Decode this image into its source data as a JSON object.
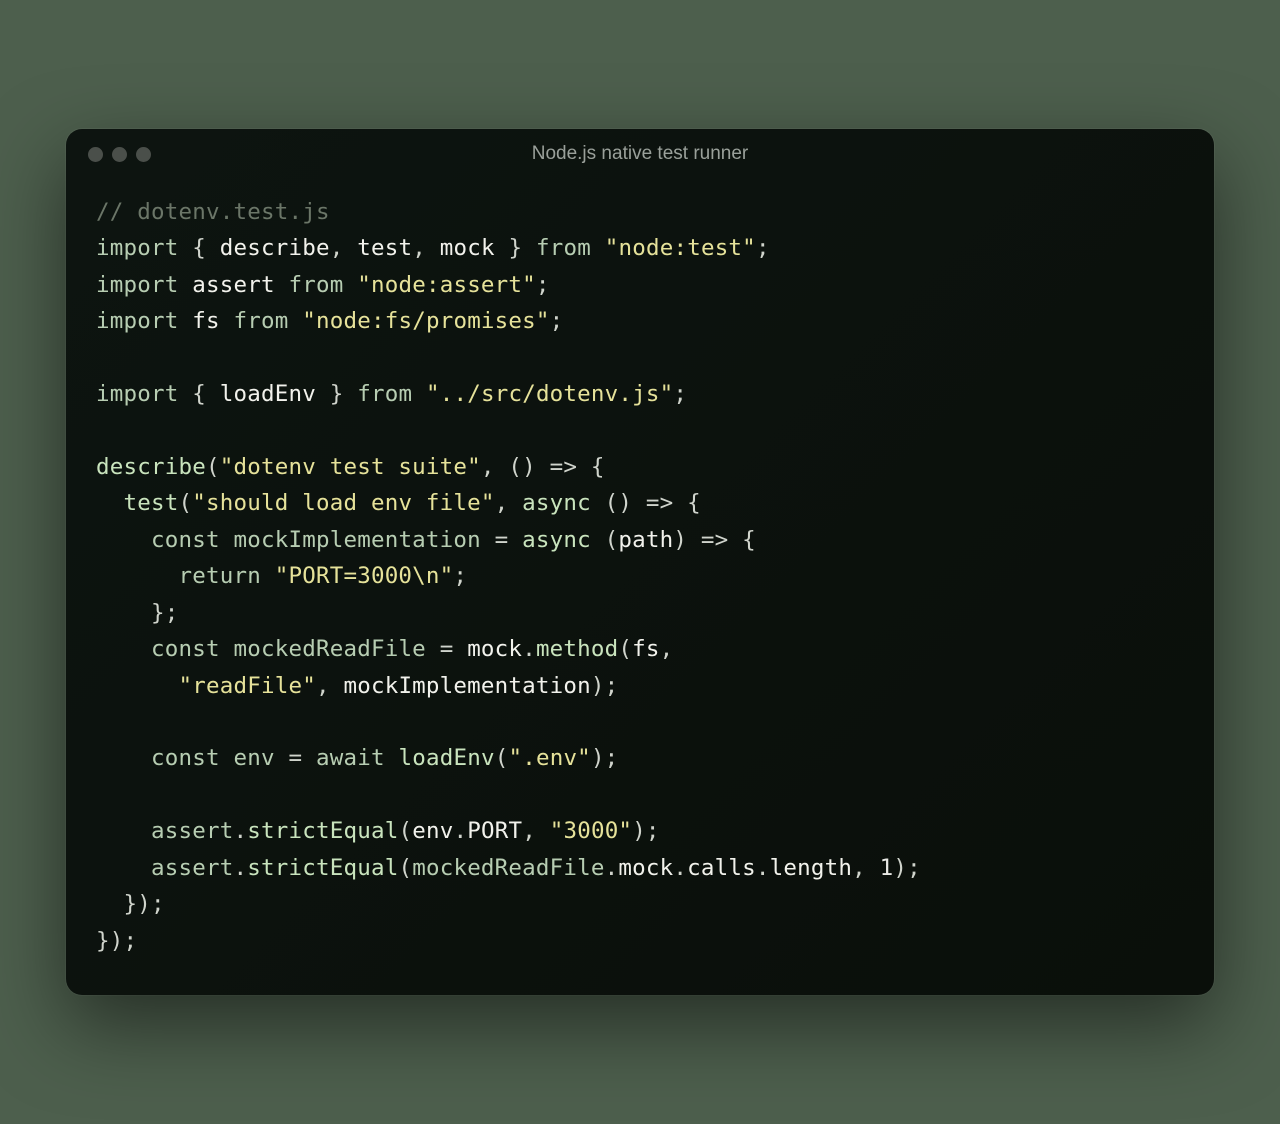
{
  "window": {
    "title": "Node.js native test runner"
  },
  "code": {
    "comment": "// dotenv.test.js",
    "kw_import": "import",
    "kw_from": "from",
    "kw_const": "const",
    "kw_return": "return",
    "kw_await": "await",
    "kw_async": "async",
    "brace_open": "{",
    "brace_close": "}",
    "id_describe": "describe",
    "id_test": "test",
    "id_mock": "mock",
    "id_assert": "assert",
    "id_fs": "fs",
    "id_loadEnv": "loadEnv",
    "id_mockImplementation": "mockImplementation",
    "id_mockedReadFile": "mockedReadFile",
    "id_env": "env",
    "id_path": "path",
    "id_method": "method",
    "id_strictEqual": "strictEqual",
    "id_PORT": "PORT",
    "id_calls": "calls",
    "id_length": "length",
    "str_nodetest": "\"node:test\"",
    "str_nodeassert": "\"node:assert\"",
    "str_nodefs": "\"node:fs/promises\"",
    "str_dotenvpath": "\"../src/dotenv.js\"",
    "str_suite": "\"dotenv test suite\"",
    "str_should": "\"should load env file\"",
    "str_port3000n": "\"PORT=3000\\n\"",
    "str_readFile": "\"readFile\"",
    "str_dotenv": "\".env\"",
    "str_3000": "\"3000\"",
    "num_1": "1"
  }
}
